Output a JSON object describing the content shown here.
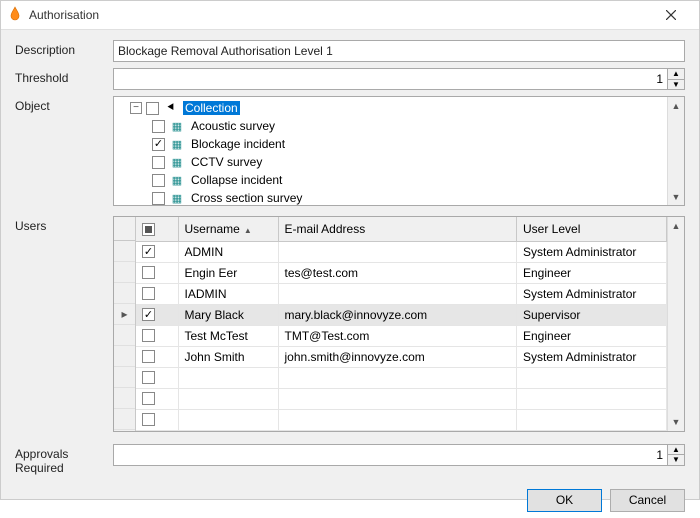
{
  "window": {
    "title": "Authorisation"
  },
  "fields": {
    "description": {
      "label": "Description",
      "value": "Blockage Removal Authorisation Level 1"
    },
    "threshold": {
      "label": "Threshold",
      "value": "1"
    },
    "object": {
      "label": "Object"
    },
    "users": {
      "label": "Users"
    },
    "approvals": {
      "label": "Approvals Required",
      "value": "1"
    }
  },
  "object_tree": {
    "root": {
      "label": "Collection",
      "selected": true
    },
    "children": [
      {
        "label": "Acoustic survey",
        "checked": false
      },
      {
        "label": "Blockage incident",
        "checked": true
      },
      {
        "label": "CCTV survey",
        "checked": false
      },
      {
        "label": "Collapse incident",
        "checked": false
      },
      {
        "label": "Cross section survey",
        "checked": false
      }
    ]
  },
  "users_grid": {
    "columns": {
      "username": "Username",
      "email": "E-mail Address",
      "level": "User Level"
    },
    "sort_column": "username",
    "rows": [
      {
        "checked": true,
        "username": "ADMIN",
        "email": "",
        "level": "System Administrator",
        "current": false
      },
      {
        "checked": false,
        "username": "Engin Eer",
        "email": "tes@test.com",
        "level": "Engineer",
        "current": false
      },
      {
        "checked": false,
        "username": "IADMIN",
        "email": "",
        "level": "System Administrator",
        "current": false
      },
      {
        "checked": true,
        "username": "Mary Black",
        "email": "mary.black@innovyze.com",
        "level": "Supervisor",
        "current": true
      },
      {
        "checked": false,
        "username": "Test McTest",
        "email": "TMT@Test.com",
        "level": "Engineer",
        "current": false
      },
      {
        "checked": false,
        "username": "John Smith",
        "email": "john.smith@innovyze.com",
        "level": "System Administrator",
        "current": false
      },
      {
        "checked": false,
        "username": "",
        "email": "",
        "level": "",
        "current": false
      },
      {
        "checked": false,
        "username": "",
        "email": "",
        "level": "",
        "current": false
      },
      {
        "checked": false,
        "username": "",
        "email": "",
        "level": "",
        "current": false
      }
    ]
  },
  "buttons": {
    "ok": "OK",
    "cancel": "Cancel"
  }
}
